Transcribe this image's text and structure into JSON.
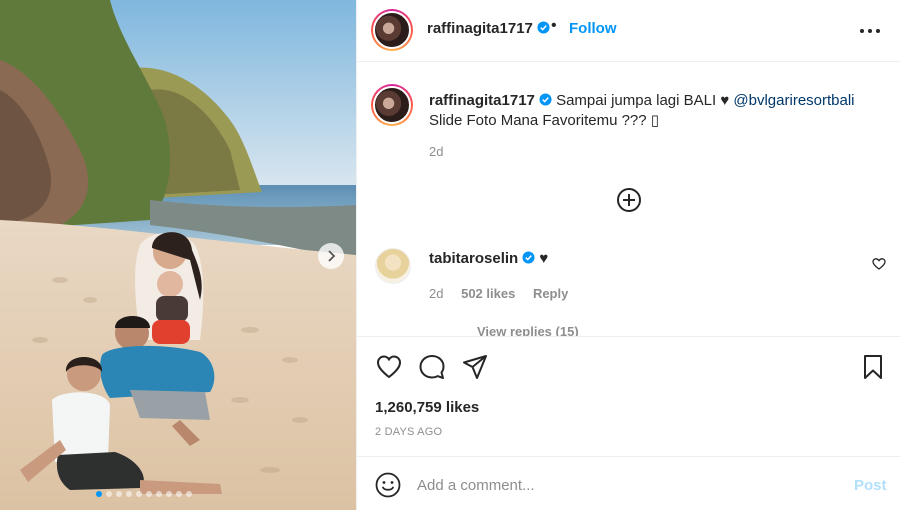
{
  "post": {
    "username": "raffinagita1717",
    "separator": "•",
    "follow_label": "Follow",
    "caption": {
      "username": "raffinagita1717",
      "text": "Sampai jumpa lagi BALI",
      "heart": "♥",
      "mention": "@bvlgariresortbali",
      "line2": "Slide Foto Mana Favoritemu ??? ",
      "line2_glyph": "▯",
      "time": "2d"
    },
    "comment": {
      "username": "tabitaroselin",
      "heart": "♥",
      "time": "2d",
      "likes": "502 likes",
      "reply_label": "Reply",
      "view_replies": "View replies (15)"
    },
    "likes": "1,260,759 likes",
    "date": "2 DAYS AGO",
    "comment_placeholder": "Add a comment...",
    "post_label": "Post"
  },
  "icons": {
    "verified": "verified-badge-icon",
    "more": "more-options-icon",
    "add_more": "load-more-comments-icon",
    "like": "heart-icon",
    "comment": "comment-icon",
    "share": "share-icon",
    "save": "bookmark-icon",
    "emoji": "emoji-icon",
    "next": "chevron-right-icon"
  },
  "colors": {
    "accent": "#0095f6",
    "muted": "#8e8e8e",
    "text": "#262626",
    "mention": "#00376b",
    "post_disabled": "#b2dffc"
  },
  "carousel": {
    "slides": 10,
    "active_index": 0
  }
}
